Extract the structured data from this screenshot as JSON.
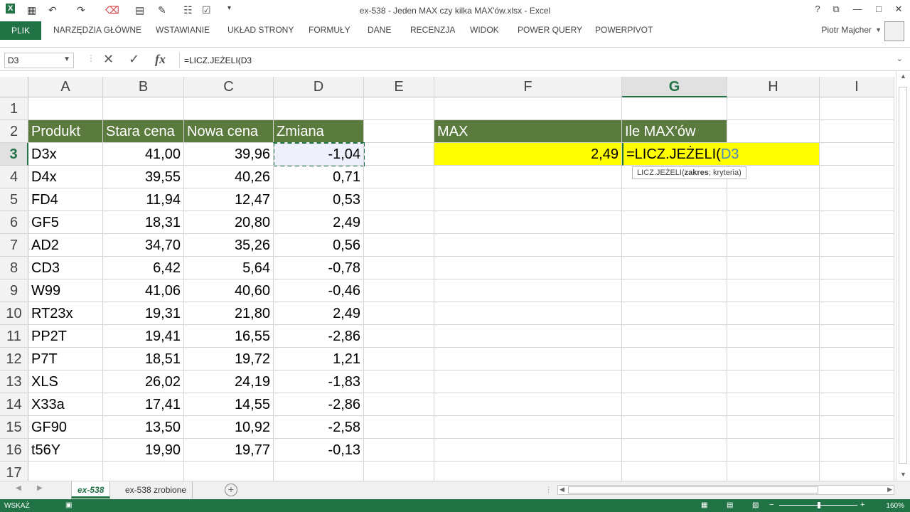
{
  "window": {
    "title": "ex-538 - Jeden MAX czy kilka MAX'ów.xlsx - Excel",
    "help": "?",
    "restore": "⧉",
    "minimize": "—",
    "maximize": "□",
    "close": "✕"
  },
  "qat": {
    "app_icon": "X",
    "save": "💾",
    "undo": "↶",
    "redo": "↷"
  },
  "ribbon": {
    "file": "PLIK",
    "tabs": [
      "NARZĘDZIA GŁÓWNE",
      "WSTAWIANIE",
      "UKŁAD STRONY",
      "FORMUŁY",
      "DANE",
      "RECENZJA",
      "WIDOK",
      "POWER QUERY",
      "POWERPIVOT"
    ],
    "user": "Piotr Majcher"
  },
  "formula_bar": {
    "name_box": "D3",
    "cancel": "✕",
    "enter": "✓",
    "fx": "fx",
    "formula": "=LICZ.JEŻELI(D3"
  },
  "columns": [
    "A",
    "B",
    "C",
    "D",
    "E",
    "F",
    "G",
    "H",
    "I"
  ],
  "rows": [
    "1",
    "2",
    "3",
    "4",
    "5",
    "6",
    "7",
    "8",
    "9",
    "10",
    "11",
    "12",
    "13",
    "14",
    "15",
    "16",
    "17"
  ],
  "table": {
    "headers": [
      "Produkt",
      "Stara cena",
      "Nowa cena",
      "Zmiana"
    ],
    "rows": [
      [
        "D3x",
        "41,00",
        "39,96",
        "-1,04"
      ],
      [
        "D4x",
        "39,55",
        "40,26",
        "0,71"
      ],
      [
        "FD4",
        "11,94",
        "12,47",
        "0,53"
      ],
      [
        "GF5",
        "18,31",
        "20,80",
        "2,49"
      ],
      [
        "AD2",
        "34,70",
        "35,26",
        "0,56"
      ],
      [
        "CD3",
        "6,42",
        "5,64",
        "-0,78"
      ],
      [
        "W99",
        "41,06",
        "40,60",
        "-0,46"
      ],
      [
        "RT23x",
        "19,31",
        "21,80",
        "2,49"
      ],
      [
        "PP2T",
        "19,41",
        "16,55",
        "-2,86"
      ],
      [
        "P7T",
        "18,51",
        "19,72",
        "1,21"
      ],
      [
        "XLS",
        "26,02",
        "24,19",
        "-1,83"
      ],
      [
        "X33a",
        "17,41",
        "14,55",
        "-2,86"
      ],
      [
        "GF90",
        "13,50",
        "10,92",
        "-2,58"
      ],
      [
        "t56Y",
        "19,90",
        "19,77",
        "-0,13"
      ]
    ]
  },
  "side": {
    "max_header": "MAX",
    "count_header": "Ile MAX'ów",
    "max_value": "2,49",
    "edit_formula_prefix": "=LICZ.JEŻELI(",
    "edit_formula_ref": "D3"
  },
  "tooltip": {
    "fn": "LICZ.JEŻELI(",
    "arg1": "zakres",
    "rest": "; kryteria)"
  },
  "sheets": {
    "active": "ex-538",
    "other": "ex-538 zrobione",
    "add": "+"
  },
  "status": {
    "mode": "WSKAŻ",
    "zoom": "160%"
  },
  "colors": {
    "accent": "#217346",
    "header_fill": "#5a7a3e",
    "highlight": "#ffff00"
  }
}
